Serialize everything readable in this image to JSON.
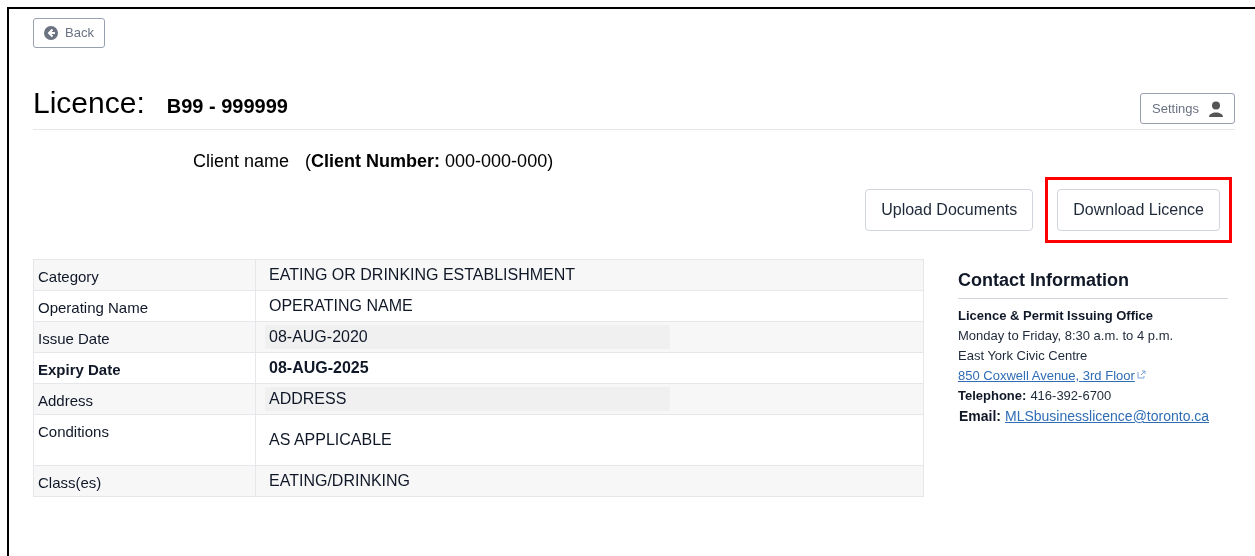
{
  "back_button": {
    "label": "Back"
  },
  "header": {
    "title": "Licence:",
    "licence_number": "B99 - 999999",
    "settings_button": {
      "label": "Settings"
    }
  },
  "client": {
    "name": "Client name",
    "number_line": "(**Client Number:** 000-000-000)"
  },
  "actions": [
    {
      "label": "Upload Documents",
      "highlighted": false
    },
    {
      "label": "Download Licence",
      "highlighted": true
    }
  ],
  "details_table": {
    "rows": [
      {
        "label": "Category",
        "value": "EATING OR DRINKING ESTABLISHMENT",
        "bold": false,
        "shaded": false,
        "tall": false
      },
      {
        "label": "Operating Name",
        "value": "OPERATING NAME",
        "bold": false,
        "shaded": false,
        "tall": false
      },
      {
        "label": "Issue Date",
        "value": "08-AUG-2020",
        "bold": false,
        "shaded": true,
        "tall": false
      },
      {
        "label": "Expiry Date",
        "value": "08-AUG-2025",
        "bold": true,
        "shaded": false,
        "tall": false
      },
      {
        "label": "Address",
        "value": "ADDRESS",
        "bold": false,
        "shaded": true,
        "tall": false
      },
      {
        "label": "Conditions",
        "value": "AS APPLICABLE",
        "bold": false,
        "shaded": false,
        "tall": true
      },
      {
        "label": "Class(es)",
        "value": "EATING/DRINKING",
        "bold": false,
        "shaded": false,
        "tall": false
      }
    ]
  },
  "contact": {
    "heading": "Contact Information",
    "lines": [
      {
        "kind": "title",
        "text": "Licence & Permit Issuing Office"
      },
      {
        "kind": "text",
        "text": "Monday to Friday, 8:30 a.m. to 4 p.m."
      },
      {
        "kind": "text",
        "text": "East York Civic Centre"
      },
      {
        "kind": "external_link",
        "text": "850 Coxwell Avenue, 3rd Floor"
      },
      {
        "kind": "field",
        "label": "Telephone:",
        "text": "416-392-6700"
      },
      {
        "kind": "field_link",
        "label": "Email:",
        "text": "MLSbusinesslicence@toronto.ca"
      }
    ]
  }
}
